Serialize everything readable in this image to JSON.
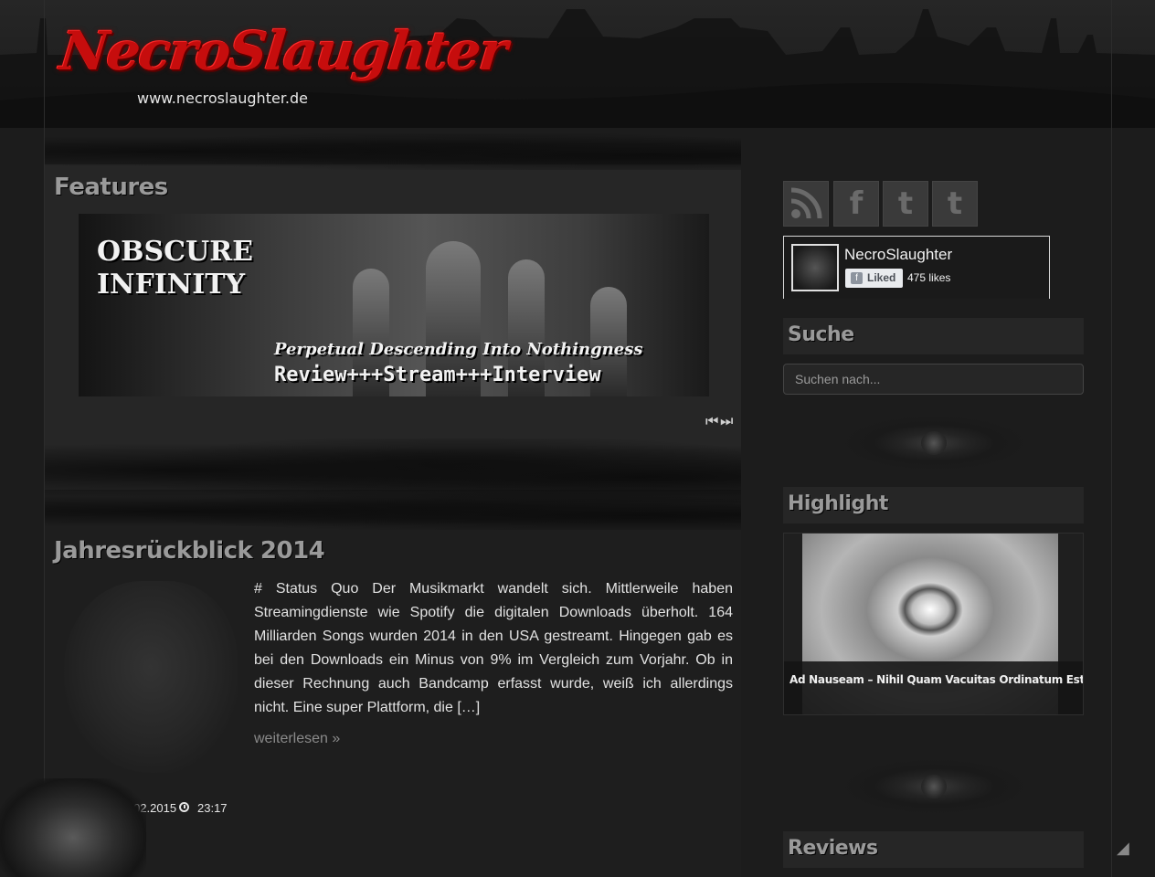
{
  "site": {
    "logo_text": "NecroSlaughter",
    "url": "www.necroslaughter.de"
  },
  "features": {
    "title": "Features",
    "banner": {
      "band": "OBSCURE INFINITY",
      "album": "Perpetual Descending Into Nothingness",
      "tagline": "Review+++Stream+++Interview"
    },
    "prev_icon": "⏮",
    "next_icon": "⏭"
  },
  "article": {
    "title": "Jahresrückblick 2014",
    "excerpt": "# Status Quo Der Musikmarkt wandelt sich. Mittlerweile haben Streamingdienste wie Spotify die digitalen Downloads überholt. 164 Milliarden Songs wurden 2014 in den USA gestreamt. Hingegen gab es bei den Downloads ein Minus von 9% im Vergleich zum Vorjahr. Ob in dieser Rechnung auch Bandcamp erfasst wurde, weiß ich allerdings nicht. Eine super Plattform, die […]",
    "read_more": "weiterlesen »",
    "date": "23.02.2015",
    "time": "23:17"
  },
  "social": {
    "rss": "RSS",
    "facebook": "f",
    "twitter": "t",
    "tumblr": "t"
  },
  "facebook_box": {
    "page_name": "NecroSlaughter",
    "liked_label": "Liked",
    "likes": "475 likes"
  },
  "sidebar": {
    "search_title": "Suche",
    "search_placeholder": "Suchen nach...",
    "highlight_title": "Highlight",
    "highlight_caption": "Ad Nauseam – Nihil Quam Vacuitas Ordinatum Est",
    "reviews_title": "Reviews"
  },
  "colors": {
    "background": "#1c1c1c",
    "logo_red": "#c60d0d",
    "heading_gray": "#9a9a9a"
  }
}
